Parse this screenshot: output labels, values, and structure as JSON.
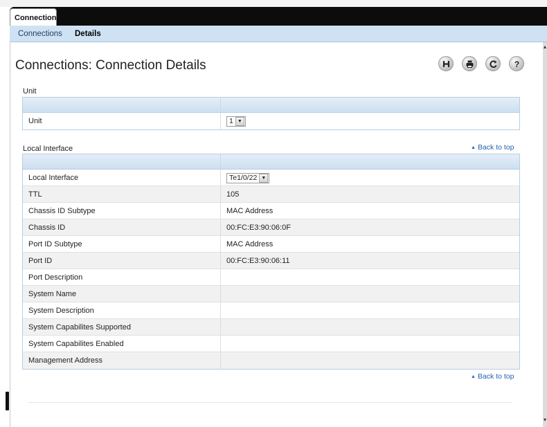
{
  "app_tab": {
    "label": "Connections"
  },
  "subnav": {
    "items": [
      "Connections",
      "Details"
    ],
    "selected": "Details"
  },
  "page": {
    "title": "Connections: Connection Details"
  },
  "toolbar": {
    "icons": [
      "save-icon",
      "print-icon",
      "refresh-icon",
      "help-icon"
    ]
  },
  "unit_section": {
    "label": "Unit",
    "row_label": "Unit",
    "select_value": "1"
  },
  "local_interface_section": {
    "label": "Local Interface",
    "back_to_top": "Back to top",
    "interface_label": "Local Interface",
    "interface_value": "Te1/0/22",
    "rows": [
      {
        "label": "TTL",
        "value": "105"
      },
      {
        "label": "Chassis ID Subtype",
        "value": "MAC Address"
      },
      {
        "label": "Chassis ID",
        "value": "00:FC:E3:90:06:0F"
      },
      {
        "label": "Port ID Subtype",
        "value": "MAC Address"
      },
      {
        "label": "Port ID",
        "value": "00:FC:E3:90:06:11"
      },
      {
        "label": "Port Description",
        "value": ""
      },
      {
        "label": "System Name",
        "value": ""
      },
      {
        "label": "System Description",
        "value": ""
      },
      {
        "label": "System Capabilites Supported",
        "value": ""
      },
      {
        "label": "System Capabilites Enabled",
        "value": ""
      },
      {
        "label": "Management Address",
        "value": ""
      }
    ]
  },
  "footer": {
    "back_to_top": "Back to top"
  },
  "colors": {
    "tab_bar": "#0c0c0c",
    "subnav_bg": "#cfe2f3",
    "link": "#2461b0",
    "table_header": "#cddff0"
  }
}
